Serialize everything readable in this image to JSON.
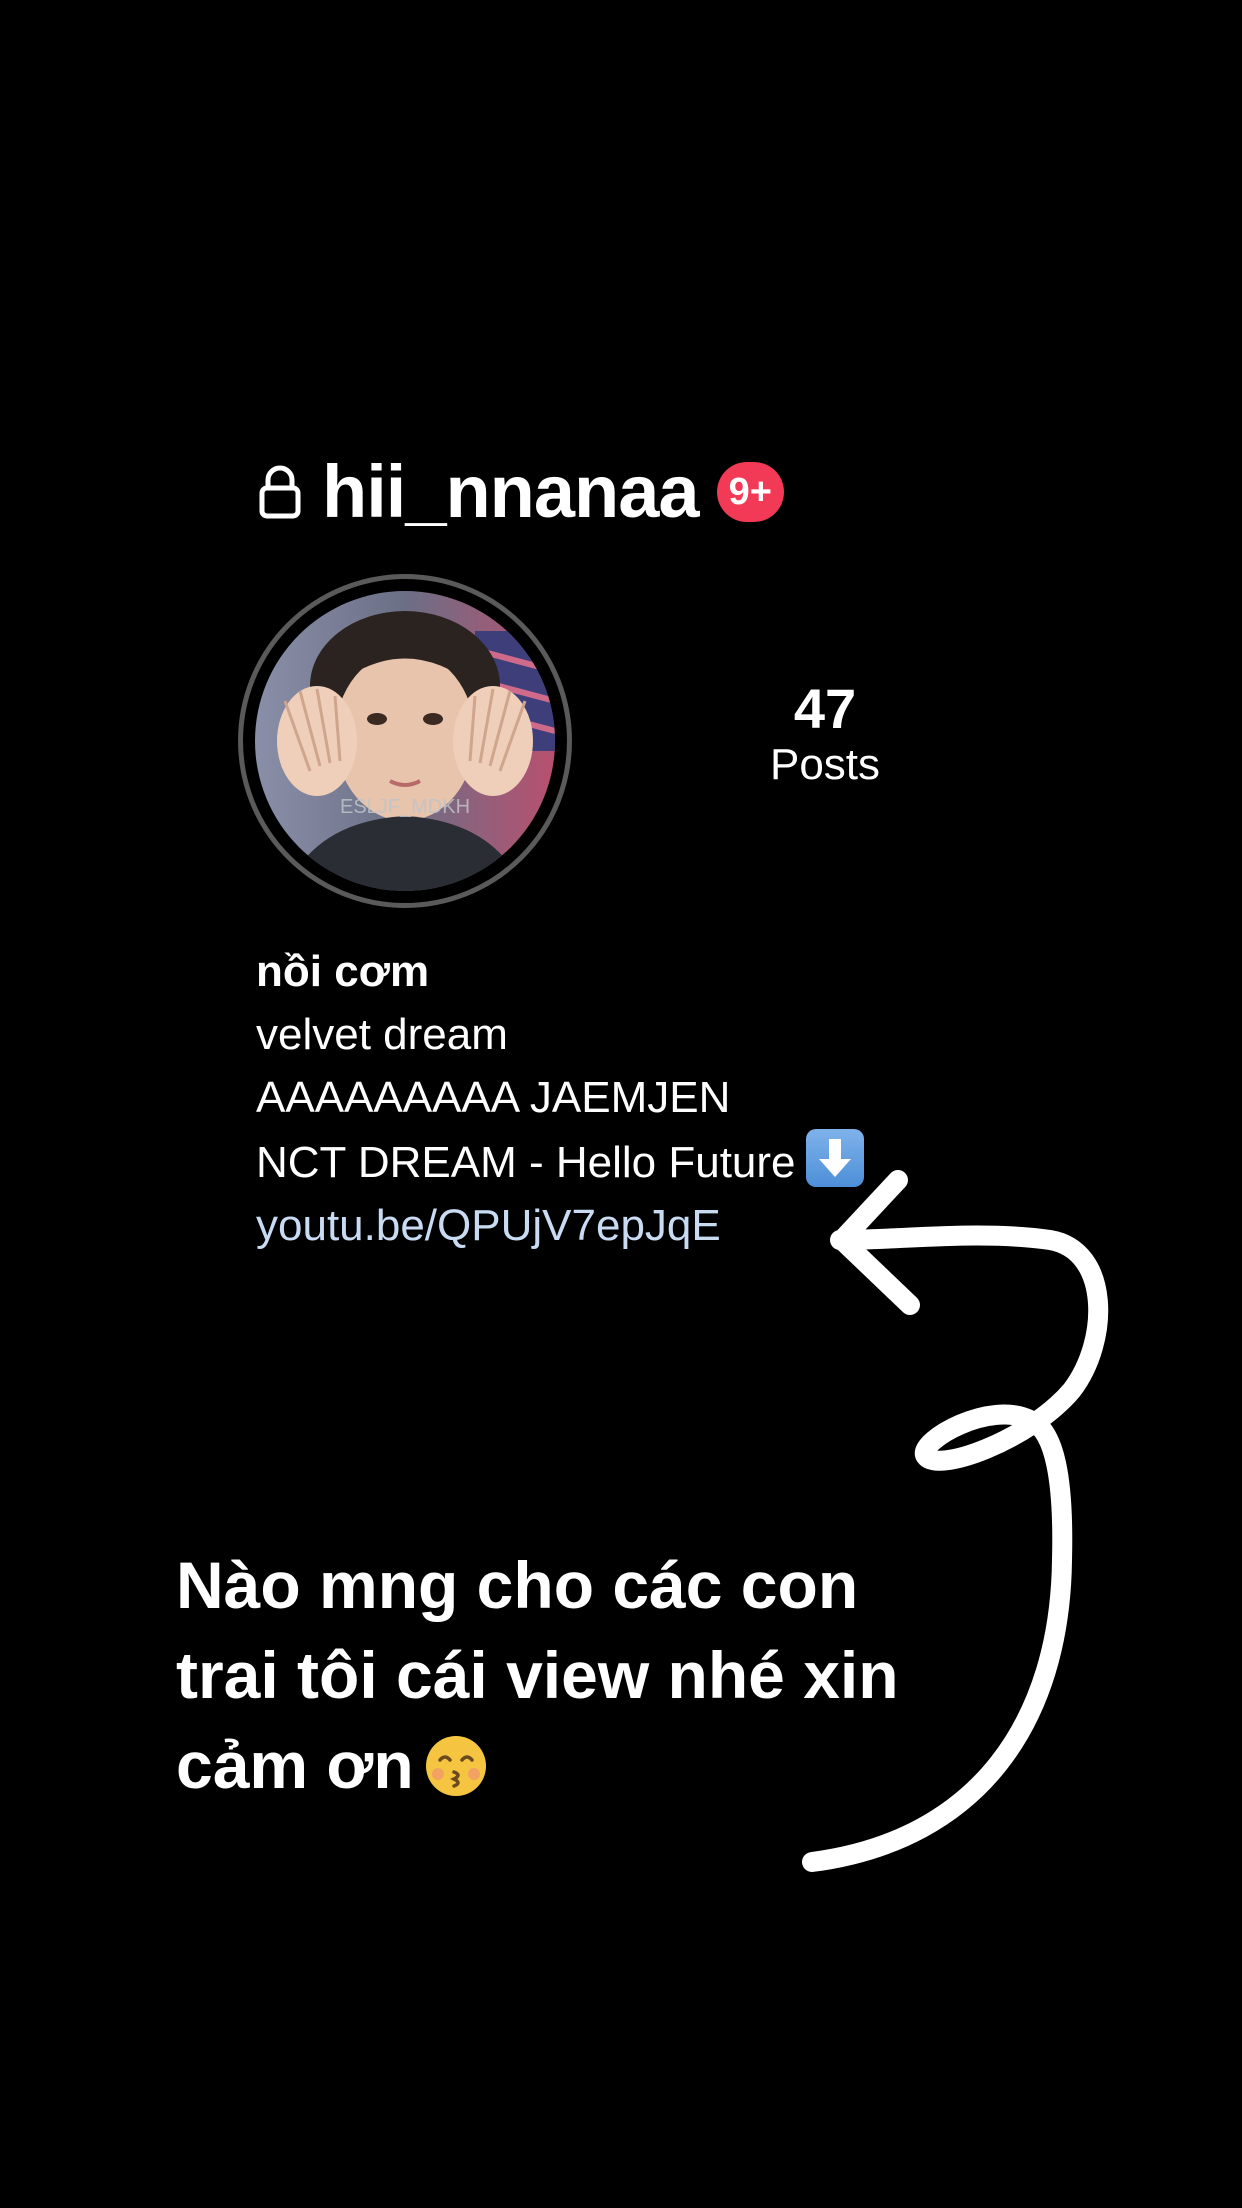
{
  "profile": {
    "username": "hii_nnanaa",
    "notification_badge": "9+",
    "avatar_watermark": "ESLJF_MDKH",
    "stats": {
      "posts_count": "47",
      "posts_label": "Posts"
    },
    "bio": {
      "name": "nồi cơm",
      "line1": "velvet dream",
      "line2": "AAAAAAAAA JAEMJEN",
      "line3": "NCT DREAM - Hello Future",
      "link": "youtu.be/QPUjV7epJqE"
    }
  },
  "overlay": {
    "caption_line1": "Nào mng cho các con",
    "caption_line2": "trai tôi cái view nhé xin",
    "caption_line3": "cảm ơn"
  },
  "icons": {
    "lock": "lock-icon",
    "download_emoji": "down-arrow-emoji",
    "kiss_emoji": "kissing-face-emoji"
  },
  "colors": {
    "background": "#000000",
    "badge": "#f23a57",
    "link": "#c8dbf3",
    "text": "#ffffff"
  }
}
